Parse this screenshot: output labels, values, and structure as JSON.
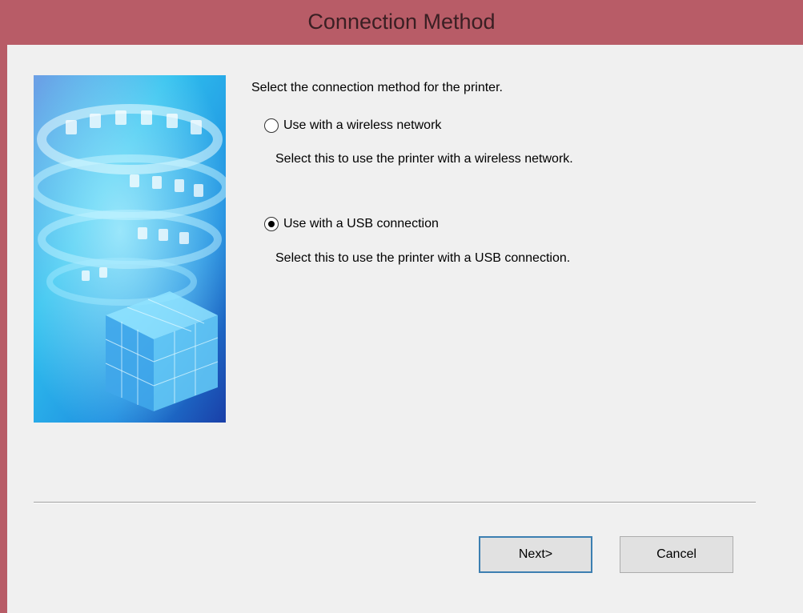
{
  "window": {
    "title": "Connection Method"
  },
  "content": {
    "instruction": "Select the connection method for the printer."
  },
  "options": [
    {
      "label": "Use with a wireless network",
      "description": "Select this to use the printer with a wireless network.",
      "checked": false
    },
    {
      "label": "Use with a USB connection",
      "description": "Select this to use the printer with a USB connection.",
      "checked": true
    }
  ],
  "buttons": {
    "next_label": "Next>",
    "cancel_label": "Cancel"
  },
  "colors": {
    "title_bar": "#b85c67",
    "dialog_background": "#f0f0f0",
    "default_button_border": "#3c7fb1"
  },
  "icons": {
    "banner": "printer-network-illustration"
  }
}
